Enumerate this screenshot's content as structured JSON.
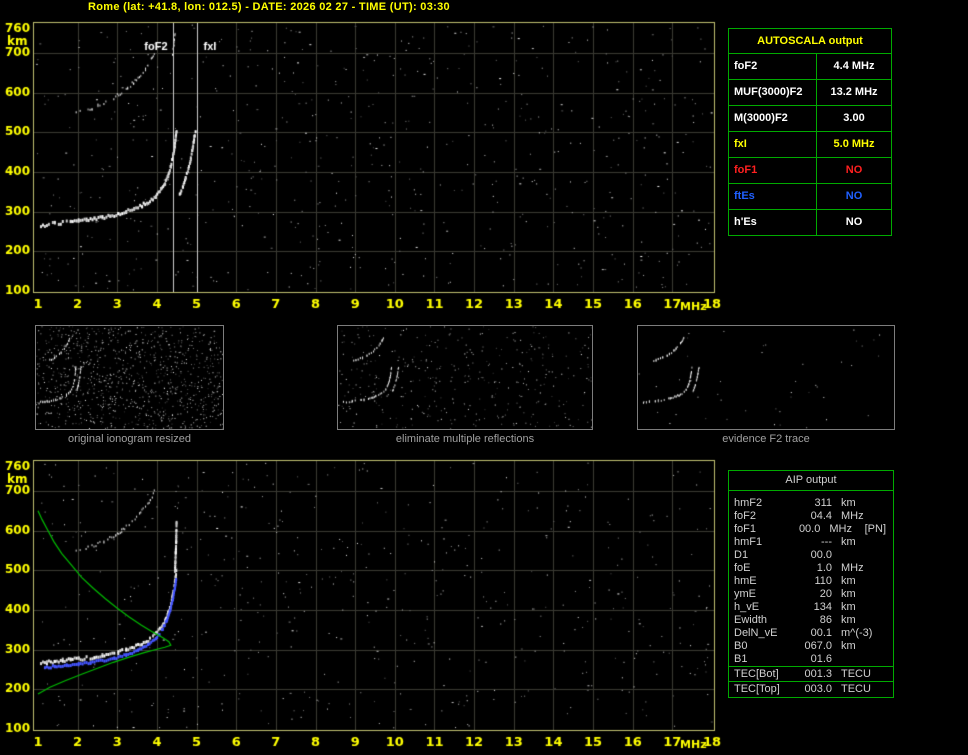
{
  "title": "Rome (lat: +41.8, lon: 012.5) - DATE: 2026 02 27 - TIME (UT): 03:30",
  "colors": {
    "axis_text": "#ffff00",
    "frame": "#c0c070",
    "grid": "#3a3a32",
    "annotation_line": "#cccccc",
    "table_border": "#00aa00",
    "profile_green": "#00bb00",
    "restored_blue": "#4455ff"
  },
  "chart_data": [
    {
      "id": "top_ionogram",
      "type": "scatter",
      "title": "measured ionogram",
      "xlabel": "MHz",
      "ylabel": "km",
      "xlim": [
        1,
        18
      ],
      "ylim": [
        100,
        760
      ],
      "xticks": [
        1,
        2,
        3,
        4,
        5,
        6,
        7,
        8,
        9,
        10,
        11,
        12,
        13,
        14,
        15,
        16,
        17,
        18
      ],
      "yticks": [
        100,
        200,
        300,
        400,
        500,
        600,
        700,
        760
      ],
      "grid": true,
      "legend": "none",
      "annotations": [
        {
          "label": "foF2",
          "x_mhz": 4.4,
          "label_side": "left"
        },
        {
          "label": "fxI",
          "x_mhz": 5.0,
          "label_side": "right"
        }
      ],
      "series": [
        {
          "name": "f2-trace-first-order",
          "color": "#ffffff",
          "style": "thick-dots",
          "seed": 101,
          "gap": 0.1,
          "jitter": 1.6,
          "points": [
            [
              1.05,
              268
            ],
            [
              1.2,
              271
            ],
            [
              1.4,
              273
            ],
            [
              1.6,
              276
            ],
            [
              1.8,
              278
            ],
            [
              2.0,
              280
            ],
            [
              2.2,
              282
            ],
            [
              2.4,
              285
            ],
            [
              2.6,
              288
            ],
            [
              2.8,
              292
            ],
            [
              3.0,
              297
            ],
            [
              3.2,
              303
            ],
            [
              3.4,
              310
            ],
            [
              3.6,
              319
            ],
            [
              3.8,
              330
            ],
            [
              3.95,
              343
            ],
            [
              4.08,
              358
            ],
            [
              4.18,
              375
            ],
            [
              4.26,
              395
            ],
            [
              4.33,
              418
            ],
            [
              4.38,
              442
            ],
            [
              4.42,
              466
            ],
            [
              4.45,
              490
            ],
            [
              4.47,
              505
            ]
          ]
        },
        {
          "name": "f2-trace-x-mode",
          "color": "#ffffff",
          "style": "thick-dots",
          "seed": 102,
          "gap": 0.2,
          "jitter": 1.4,
          "points": [
            [
              4.55,
              348
            ],
            [
              4.63,
              368
            ],
            [
              4.7,
              388
            ],
            [
              4.77,
              412
            ],
            [
              4.83,
              438
            ],
            [
              4.88,
              465
            ],
            [
              4.92,
              490
            ],
            [
              4.95,
              505
            ]
          ]
        },
        {
          "name": "second-order-reflection",
          "color": "#ffffff",
          "style": "dots",
          "seed": 103,
          "gap": 0.35,
          "jitter": 1.8,
          "points": [
            [
              1.9,
              548
            ],
            [
              2.05,
              552
            ],
            [
              2.2,
              557
            ],
            [
              2.35,
              562
            ],
            [
              2.5,
              568
            ],
            [
              2.65,
              575
            ],
            [
              2.8,
              583
            ],
            [
              2.95,
              592
            ],
            [
              3.1,
              602
            ],
            [
              3.25,
              614
            ],
            [
              3.4,
              628
            ],
            [
              3.55,
              644
            ],
            [
              3.7,
              662
            ],
            [
              3.82,
              680
            ],
            [
              3.92,
              700
            ]
          ]
        },
        {
          "name": "foF2-asymptote-top",
          "color": "#ffffff",
          "style": "dots",
          "seed": 104,
          "gap": 0.3,
          "jitter": 1.0,
          "points": [
            [
              4.38,
              700
            ],
            [
              4.41,
              720
            ],
            [
              4.43,
              738
            ],
            [
              4.45,
              756
            ]
          ]
        }
      ],
      "noise": {
        "count": 650,
        "seed": 11
      }
    },
    {
      "id": "bottom_ionogram",
      "type": "scatter",
      "title": "restored trace and electron density profile",
      "xlabel": "MHz",
      "ylabel": "km",
      "xlim": [
        1,
        18
      ],
      "ylim": [
        100,
        760
      ],
      "xticks": [
        1,
        2,
        3,
        4,
        5,
        6,
        7,
        8,
        9,
        10,
        11,
        12,
        13,
        14,
        15,
        16,
        17,
        18
      ],
      "yticks": [
        100,
        200,
        300,
        400,
        500,
        600,
        700,
        760
      ],
      "grid": true,
      "legend": "none",
      "annotations": [],
      "series": [
        {
          "name": "f2-trace-measured",
          "color": "#ffffff",
          "style": "thick-dots",
          "seed": 201,
          "gap": 0.18,
          "jitter": 1.6,
          "points": [
            [
              1.05,
              268
            ],
            [
              1.2,
              271
            ],
            [
              1.4,
              273
            ],
            [
              1.6,
              276
            ],
            [
              1.8,
              278
            ],
            [
              2.0,
              280
            ],
            [
              2.2,
              282
            ],
            [
              2.4,
              285
            ],
            [
              2.6,
              288
            ],
            [
              2.8,
              292
            ],
            [
              3.0,
              297
            ],
            [
              3.2,
              303
            ],
            [
              3.4,
              310
            ],
            [
              3.6,
              319
            ],
            [
              3.8,
              330
            ],
            [
              3.95,
              343
            ],
            [
              4.08,
              358
            ],
            [
              4.18,
              375
            ],
            [
              4.26,
              395
            ],
            [
              4.33,
              418
            ],
            [
              4.38,
              442
            ],
            [
              4.42,
              466
            ],
            [
              4.45,
              490
            ],
            [
              4.47,
              505
            ]
          ]
        },
        {
          "name": "second-order-reflection",
          "color": "#ffffff",
          "style": "dots",
          "seed": 202,
          "gap": 0.38,
          "jitter": 1.8,
          "points": [
            [
              1.9,
              548
            ],
            [
              2.05,
              552
            ],
            [
              2.2,
              557
            ],
            [
              2.35,
              562
            ],
            [
              2.5,
              568
            ],
            [
              2.65,
              575
            ],
            [
              2.8,
              583
            ],
            [
              2.95,
              592
            ],
            [
              3.1,
              602
            ],
            [
              3.25,
              614
            ],
            [
              3.4,
              628
            ],
            [
              3.55,
              644
            ],
            [
              3.7,
              662
            ],
            [
              3.82,
              680
            ],
            [
              3.92,
              700
            ]
          ]
        },
        {
          "name": "foF2-asymptote",
          "color": "#ffffff",
          "style": "thick-dots",
          "seed": 203,
          "gap": 0.1,
          "jitter": 0.8,
          "points": [
            [
              4.43,
              500
            ],
            [
              4.44,
              525
            ],
            [
              4.45,
              550
            ],
            [
              4.46,
              575
            ],
            [
              4.465,
              600
            ],
            [
              4.47,
              625
            ]
          ]
        },
        {
          "name": "restored-trace",
          "color": "#4455ff",
          "style": "thick-dots",
          "seed": 204,
          "gap": 0.05,
          "jitter": 1.0,
          "points": [
            [
              1.15,
              258
            ],
            [
              1.4,
              261
            ],
            [
              1.7,
              264
            ],
            [
              2.0,
              267
            ],
            [
              2.3,
              271
            ],
            [
              2.6,
              276
            ],
            [
              2.9,
              282
            ],
            [
              3.2,
              290
            ],
            [
              3.5,
              301
            ],
            [
              3.75,
              315
            ],
            [
              3.95,
              332
            ],
            [
              4.1,
              352
            ],
            [
              4.22,
              376
            ],
            [
              4.31,
              403
            ],
            [
              4.38,
              432
            ],
            [
              4.43,
              460
            ],
            [
              4.46,
              482
            ]
          ]
        },
        {
          "name": "electron-density-profile",
          "color": "#00bb00",
          "style": "line",
          "points": [
            [
              1.0,
              188
            ],
            [
              1.3,
              205
            ],
            [
              1.7,
              222
            ],
            [
              2.1,
              238
            ],
            [
              2.5,
              253
            ],
            [
              2.9,
              268
            ],
            [
              3.3,
              281
            ],
            [
              3.7,
              293
            ],
            [
              4.0,
              301
            ],
            [
              4.2,
              306
            ],
            [
              4.35,
              311
            ],
            [
              4.3,
              320
            ],
            [
              4.15,
              330
            ],
            [
              3.9,
              344
            ],
            [
              3.6,
              362
            ],
            [
              3.3,
              382
            ],
            [
              3.0,
              404
            ],
            [
              2.7,
              428
            ],
            [
              2.4,
              454
            ],
            [
              2.1,
              482
            ],
            [
              1.85,
              512
            ],
            [
              1.6,
              542
            ],
            [
              1.4,
              572
            ],
            [
              1.25,
              600
            ],
            [
              1.1,
              628
            ],
            [
              1.0,
              650
            ]
          ]
        }
      ],
      "noise": {
        "count": 520,
        "seed": 29
      }
    }
  ],
  "thumbnails": {
    "items": [
      {
        "caption": "original ionogram resized",
        "noise": 1000,
        "seed": 3
      },
      {
        "caption": "eliminate multiple reflections",
        "noise": 380,
        "seed": 5
      },
      {
        "caption": "evidence F2 trace",
        "noise": 45,
        "seed": 9
      }
    ]
  },
  "autoscala": {
    "header": "AUTOSCALA output",
    "rows": [
      {
        "label": "foF2",
        "value": "4.4 MHz",
        "color": "#ffffff"
      },
      {
        "label": "MUF(3000)F2",
        "value": "13.2 MHz",
        "color": "#ffffff"
      },
      {
        "label": "M(3000)F2",
        "value": "3.00",
        "color": "#ffffff"
      },
      {
        "label": "fxI",
        "value": "5.0 MHz",
        "color": "#ffff00"
      },
      {
        "label": "foF1",
        "value": "NO",
        "color": "#ff2020"
      },
      {
        "label": "ftEs",
        "value": "NO",
        "color": "#2060ff"
      },
      {
        "label": "h'Es",
        "value": "NO",
        "color": "#ffffff"
      }
    ]
  },
  "aip": {
    "header": "AIP output",
    "rows": [
      {
        "label": "hmF2",
        "value": "311",
        "unit": "km",
        "extra": ""
      },
      {
        "label": "foF2",
        "value": "04.4",
        "unit": "MHz",
        "extra": ""
      },
      {
        "label": "foF1",
        "value": "00.0",
        "unit": "MHz",
        "extra": "[PN]"
      },
      {
        "label": "hmF1",
        "value": "---",
        "unit": "km",
        "extra": ""
      },
      {
        "label": "D1",
        "value": "00.0",
        "unit": "",
        "extra": ""
      },
      {
        "label": "foE",
        "value": "1.0",
        "unit": "MHz",
        "extra": ""
      },
      {
        "label": "hmE",
        "value": "110",
        "unit": "km",
        "extra": ""
      },
      {
        "label": "ymE",
        "value": "20",
        "unit": "km",
        "extra": ""
      },
      {
        "label": "h_vE",
        "value": "134",
        "unit": "km",
        "extra": ""
      },
      {
        "label": "Ewidth",
        "value": "86",
        "unit": "km",
        "extra": ""
      },
      {
        "label": "DelN_vE",
        "value": "00.1",
        "unit": "m^(-3)",
        "extra": ""
      },
      {
        "label": "B0",
        "value": "067.0",
        "unit": "km",
        "extra": ""
      },
      {
        "label": "B1",
        "value": "01.6",
        "unit": "",
        "extra": ""
      },
      {
        "label": "TEC[Bot]",
        "value": "001.3",
        "unit": "TECU",
        "extra": ""
      },
      {
        "label": "TEC[Top]",
        "value": "003.0",
        "unit": "TECU",
        "extra": ""
      }
    ]
  }
}
